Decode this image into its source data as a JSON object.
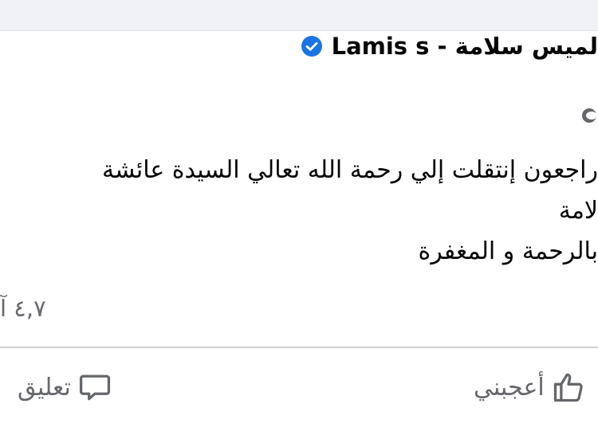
{
  "post": {
    "author": "Lamis s - لميس سلامة",
    "body_lines": [
      "راجعون إنتقلت إلي رحمة الله تعالي السيدة عائشة",
      "لامة",
      "بالرحمة و المغفرة"
    ],
    "reactions_count": "٤,٧ آ"
  },
  "actions": {
    "like_label": "أعجبني",
    "comment_label": "تعليق"
  },
  "colors": {
    "verified_badge": "#1b74e4",
    "secondary_text": "#65676b",
    "divider": "#ced0d4"
  },
  "icons": [
    "verified-badge-icon",
    "globe-icon",
    "like-thumb-icon",
    "comment-bubble-icon"
  ]
}
